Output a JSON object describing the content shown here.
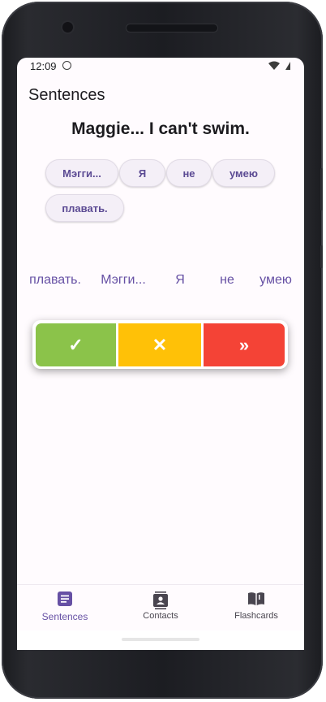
{
  "status_bar": {
    "time": "12:09"
  },
  "app": {
    "title": "Sentences"
  },
  "exercise": {
    "sentence": "Maggie... I can't swim.",
    "chips": [
      "Мэгги...",
      "Я",
      "не",
      "умею",
      "плавать."
    ],
    "shuffled_words": [
      "плавать.",
      "Мэгги...",
      "Я",
      "не",
      "умею"
    ]
  },
  "actions": {
    "correct": {
      "icon": "check-icon",
      "symbol": "✓",
      "color": "#8bc34a"
    },
    "wrong": {
      "icon": "close-icon",
      "symbol": "✕",
      "color": "#ffc107"
    },
    "skip": {
      "icon": "double-chevron-right-icon",
      "symbol": "»",
      "color": "#f44336"
    }
  },
  "bottom_nav": {
    "items": [
      {
        "label": "Sentences",
        "icon": "article-icon",
        "active": true
      },
      {
        "label": "Contacts",
        "icon": "contact-card-icon",
        "active": false
      },
      {
        "label": "Flashcards",
        "icon": "open-book-icon",
        "active": false
      }
    ]
  },
  "colors": {
    "accent": "#6650a4",
    "background": "#fffbfe"
  }
}
